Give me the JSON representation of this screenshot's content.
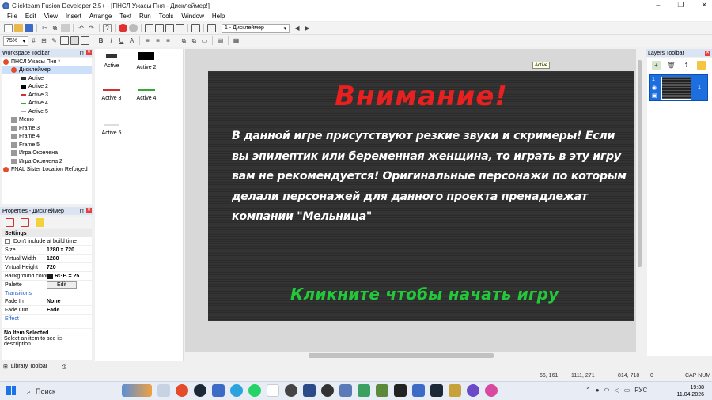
{
  "window": {
    "title": "Clickteam Fusion Developer 2.5+ - [ПНСЛ Ужасы Пня - Дисклеймер!]",
    "min": "–",
    "max": "❐",
    "close": "✕"
  },
  "menu": [
    "File",
    "Edit",
    "View",
    "Insert",
    "Arrange",
    "Text",
    "Run",
    "Tools",
    "Window",
    "Help"
  ],
  "toolbar": {
    "frame_select": "1 - Дисклеймер",
    "zoom": "75%",
    "bold": "B",
    "italic": "I",
    "underline": "U"
  },
  "workspace": {
    "header": "Workspace Toolbar",
    "tree": [
      {
        "label": "ПНСЛ Ужасы Пня *",
        "depth": 0
      },
      {
        "label": "Дисклеймер",
        "depth": 1
      },
      {
        "label": "Active",
        "depth": 2
      },
      {
        "label": "Active 2",
        "depth": 2
      },
      {
        "label": "Active 3",
        "depth": 2
      },
      {
        "label": "Active 4",
        "depth": 2
      },
      {
        "label": "Active 5",
        "depth": 2
      },
      {
        "label": "Меню",
        "depth": 1
      },
      {
        "label": "Frame 3",
        "depth": 1
      },
      {
        "label": "Frame 4",
        "depth": 1
      },
      {
        "label": "Frame 5",
        "depth": 1
      },
      {
        "label": "Игра Окончена",
        "depth": 1
      },
      {
        "label": "Игра Окончена 2",
        "depth": 1
      },
      {
        "label": "FNAL Sister Location Reforged",
        "depth": 0
      }
    ]
  },
  "properties": {
    "header": "Properties - Дисклеймер",
    "section_settings": "Settings",
    "dont_include": "Don't include at build time",
    "rows": [
      {
        "k": "Size",
        "v": "1280 x 720"
      },
      {
        "k": "Virtual Width",
        "v": "1280"
      },
      {
        "k": "Virtual Height",
        "v": "720"
      },
      {
        "k": "Background color",
        "v": "RGB = 25"
      },
      {
        "k": "Palette",
        "v": "Edit"
      }
    ],
    "section_transitions": "Transitions",
    "trans_rows": [
      {
        "k": "Fade In",
        "v": "None"
      },
      {
        "k": "Fade Out",
        "v": "Fade"
      }
    ],
    "section_effect": "Effect"
  },
  "info": {
    "title": "No Item Selected",
    "text": "Select an item to see its description"
  },
  "library": {
    "label": "Library Toolbar"
  },
  "objects": [
    {
      "label": "Active"
    },
    {
      "label": "Active 2"
    },
    {
      "label": "Active 3"
    },
    {
      "label": "Active 4"
    },
    {
      "label": "Active 5"
    }
  ],
  "frame": {
    "headline": "Внимание!",
    "body": "В данной игре присутствуют резкие звуки и скримеры! Если вы эпилептик или беременная женщина, то играть в эту игру вам не рекомендуется! Оригинальные персонажи по которым делали персонажей для данного проекта пренадлежат компании \"Мельница\"",
    "cta": "Кликните чтобы начать игру",
    "tooltip": "Active"
  },
  "layers": {
    "header": "Layers Toolbar",
    "row_num": "1",
    "row_right": "1"
  },
  "status": {
    "pos1": "66, 161",
    "pos2": "1111, 271",
    "pos3": "814, 718",
    "count": "0",
    "caps": "CAP NUM"
  },
  "taskbar": {
    "search": "Поиск",
    "lang": "РУС",
    "time": "19:38",
    "date": "11.04.2026"
  }
}
